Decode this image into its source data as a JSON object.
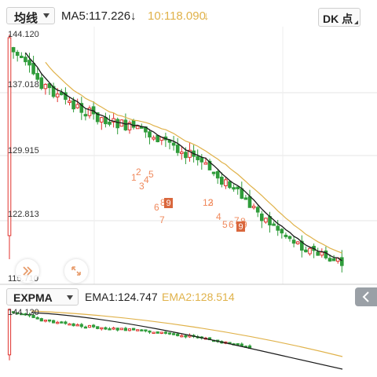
{
  "toolbar": {
    "indicator_select": "均线",
    "ma5": "MA5:117.226",
    "ma5_arrow": "↓",
    "ma10": "10:118.090",
    "ma10_arrow": "↓",
    "period_button": "DK 点"
  },
  "price_axis": {
    "labels": [
      "144.120",
      "137.018",
      "129.915",
      "122.813",
      "115.710"
    ]
  },
  "signal_labels": {
    "buy": [
      "1",
      "2",
      "3",
      "4",
      "5",
      "6",
      "8",
      "9",
      "7",
      "12",
      "3",
      "4",
      "5",
      "6",
      "7",
      "8",
      "9"
    ],
    "sell": [
      "9",
      "9"
    ]
  },
  "lower_panel": {
    "indicator_select": "EXPMA",
    "ema1": "EMA1:124.747",
    "ema2": "EMA2:128.514",
    "top_label": "144.120"
  },
  "colors": {
    "up": "#e0322e",
    "down": "#2f9c3a",
    "ma_fast": "#1a1a1a",
    "ma_slow": "#e0b24a",
    "ema2_text": "#e0b24a",
    "ma10_text": "#e0b24a",
    "signal": "#f08a5d"
  },
  "icons": {
    "double_chevron": "double-chevron-right-icon",
    "expand": "expand-arrows-icon",
    "side_arrow": "chevron-left-icon"
  }
}
